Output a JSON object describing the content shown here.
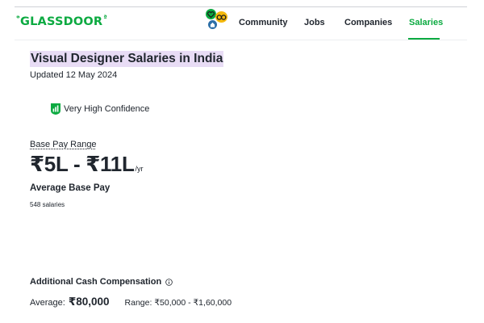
{
  "header": {
    "logo_text": "GLASSDOOR",
    "logo_mark": "ᵊ",
    "logo_reg": "ª",
    "nav": {
      "community": "Community",
      "jobs": "Jobs",
      "companies": "Companies",
      "salaries": "Salaries"
    },
    "active_tab": "Salaries",
    "community_icons": [
      "heart-icon",
      "owl-icon",
      "home-icon"
    ]
  },
  "main": {
    "title": "Visual Designer Salaries in India",
    "updated": "Updated 12 May 2024",
    "confidence": {
      "label": "Very High Confidence",
      "icon": "bar-chart-shield-icon"
    },
    "base_pay": {
      "label": "Base Pay Range",
      "range": "₹5L - ₹11L",
      "unit": "/yr",
      "average_label": "Average Base Pay",
      "count": "548 salaries"
    },
    "additional": {
      "label": "Additional Cash Compensation",
      "average_label": "Average:",
      "average_value": "₹80,000",
      "range_label": "Range:",
      "range_value": "₹50,000 - ₹1,60,000"
    }
  },
  "colors": {
    "brand": "#0caa41",
    "title_highlight": "#e8dcf5",
    "text": "#20262e"
  }
}
